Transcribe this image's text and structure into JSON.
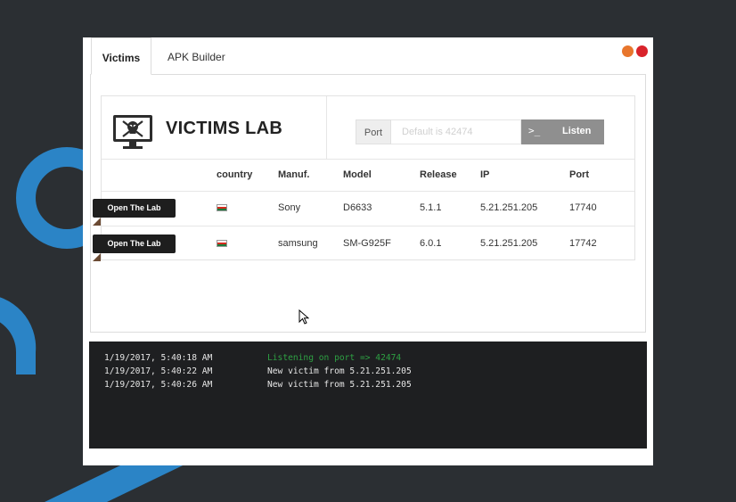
{
  "tabs": [
    {
      "label": "Victims",
      "active": true
    },
    {
      "label": "APK Builder",
      "active": false
    }
  ],
  "window_controls": {
    "minimize_color": "#e8762c",
    "close_color": "#d9232b"
  },
  "lab": {
    "title": "VICTIMS LAB",
    "icon": "monitor-skull-icon",
    "port_label": "Port",
    "port_placeholder": "Default is 42474",
    "port_value": "",
    "listen_button": "Listen",
    "listen_prompt_icon": ">_"
  },
  "table": {
    "headers": {
      "country": "country",
      "manuf": "Manuf.",
      "model": "Model",
      "release": "Release",
      "ip": "IP",
      "port": "Port"
    },
    "rows": [
      {
        "action": "Open The Lab",
        "country_flag": "flag-icon",
        "manuf": "Sony",
        "model": "D6633",
        "release": "5.1.1",
        "ip": "5.21.251.205",
        "port": "17740"
      },
      {
        "action": "Open The Lab",
        "country_flag": "flag-icon",
        "manuf": "samsung",
        "model": "SM-G925F",
        "release": "6.0.1",
        "ip": "5.21.251.205",
        "port": "17742"
      }
    ]
  },
  "console": {
    "lines": [
      {
        "time": "1/19/2017, 5:40:18 AM",
        "message": "Listening on port => 42474",
        "status": "success"
      },
      {
        "time": "1/19/2017, 5:40:22 AM",
        "message": "New victim from 5.21.251.205",
        "status": "info"
      },
      {
        "time": "1/19/2017, 5:40:26 AM",
        "message": "New victim from 5.21.251.205",
        "status": "info"
      }
    ]
  },
  "colors": {
    "background": "#2b2f33",
    "accent_blue": "#2b84c6",
    "console_bg": "#1e1f21",
    "success_text": "#2ea043",
    "listen_button": "#8f8f8f"
  }
}
